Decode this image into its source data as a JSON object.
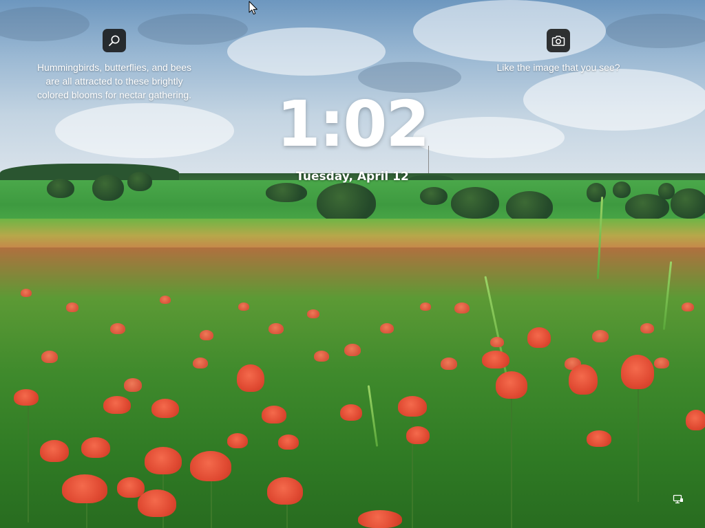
{
  "lock_screen": {
    "time": "1:02",
    "date": "Tuesday, April 12",
    "spotlight_fact": {
      "icon": "search-icon",
      "lines": [
        "Hummingbirds, butterflies, and bees",
        "are all attracted to these brightly",
        "colored blooms for nectar gathering."
      ]
    },
    "spotlight_like": {
      "icon": "camera-icon",
      "text": "Like the image that you see?"
    },
    "status": {
      "network_icon": "network-ethernet-icon"
    }
  },
  "colors": {
    "icon_tile_bg": "#181818",
    "text": "#ffffff",
    "sky": "#9ab8d3",
    "field_green": "#3f8a2c",
    "flower_red": "#e04a32"
  }
}
